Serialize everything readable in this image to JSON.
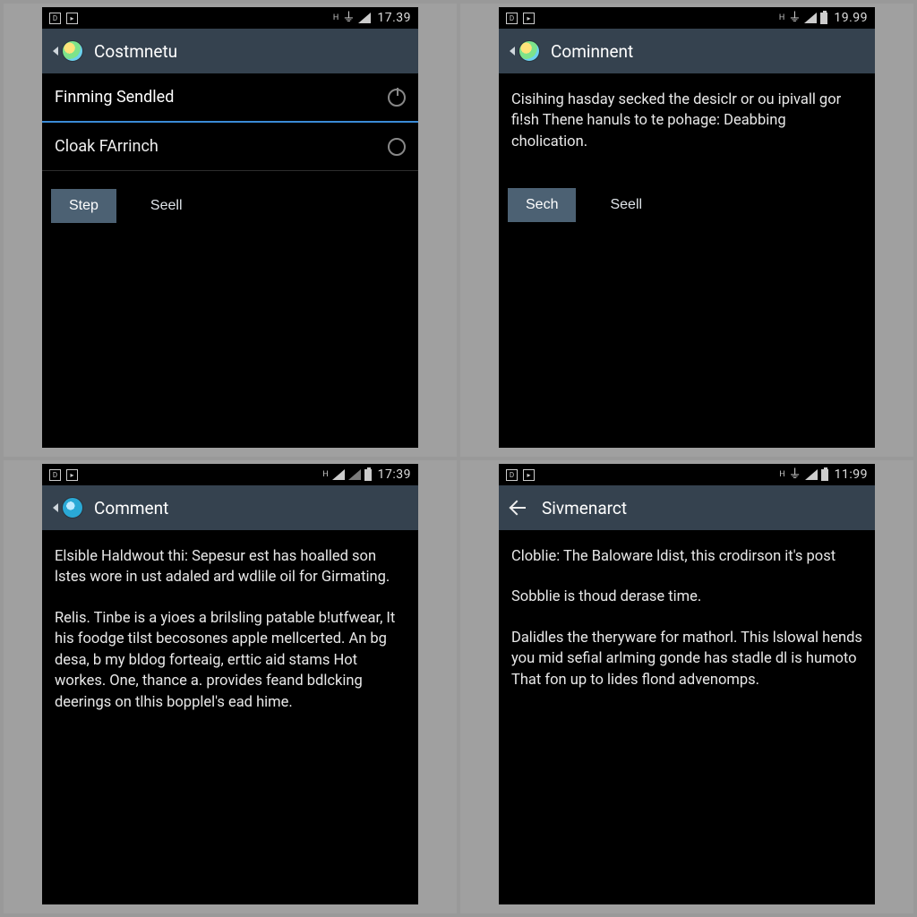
{
  "screens": {
    "tl": {
      "status": {
        "clock": "17.39"
      },
      "title": "Costmnetu",
      "rows": [
        {
          "label": "Finming Sendled",
          "active": true,
          "radio": "power"
        },
        {
          "label": "Cloak FArrinch",
          "active": false,
          "radio": "empty"
        }
      ],
      "btn_primary": "Step",
      "btn_secondary": "Seell"
    },
    "tr": {
      "status": {
        "clock": "19.99"
      },
      "title": "Cominnent",
      "paragraphs": [
        "Cisihing hasday secked the desiclr or ou ipivall gor fi!sh Thene hanuls to te pohage: Deabbing cholication."
      ],
      "btn_primary": "Sech",
      "btn_secondary": "Seell"
    },
    "bl": {
      "status": {
        "clock": "17:39"
      },
      "title": "Comment",
      "paragraphs": [
        "Elsible Haldwout thi: Sepesur est has hoalled son lstes wore in ust adaled ard wdlile oil for Girmating.",
        "Relis. Tinbe is a yioes a brilsling patable b!utfwear, It his foodge tilst becosones apple mellcerted. An bg desa, b my bldog forteaig, erttic aid stams Hot workes. One, thance a. provides feand bdlcking deerings on tlhis bopplel's ead hime."
      ]
    },
    "br": {
      "status": {
        "clock": "11:99"
      },
      "title": "Sivmenarct",
      "paragraphs": [
        "Cloblie: The Baloware ldist, this crodirson it's post",
        "Sobblie is thoud derase time.",
        "Dalidles the theryware for mathorl. This lslowal hends you mid sefial arlming gonde has stadle dl is humoto That fon up to lides flond advenomps."
      ]
    }
  }
}
